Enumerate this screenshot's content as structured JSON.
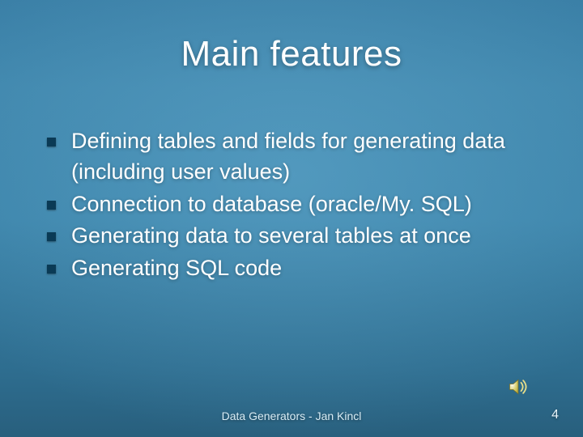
{
  "title": "Main features",
  "bullets": [
    "Defining tables and fields for generating data (including user values)",
    "Connection to database (oracle/My. SQL)",
    "Generating data to several tables at once",
    "Generating SQL code"
  ],
  "footer": "Data Generators - Jan Kincl",
  "page_number": "4",
  "icons": {
    "sound": "speaker-icon"
  }
}
